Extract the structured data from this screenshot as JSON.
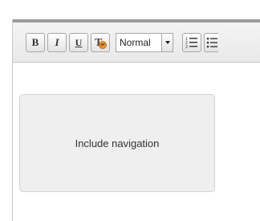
{
  "toolbar": {
    "bold_label": "B",
    "italic_label": "I",
    "underline_label": "U",
    "format_select": {
      "value": "Normal"
    }
  },
  "content": {
    "navigation_block_label": "Include navigation"
  },
  "icons": [
    "bold-icon",
    "italic-icon",
    "underline-icon",
    "clear-format-icon",
    "chevron-down-icon",
    "ordered-list-icon",
    "unordered-list-icon"
  ]
}
